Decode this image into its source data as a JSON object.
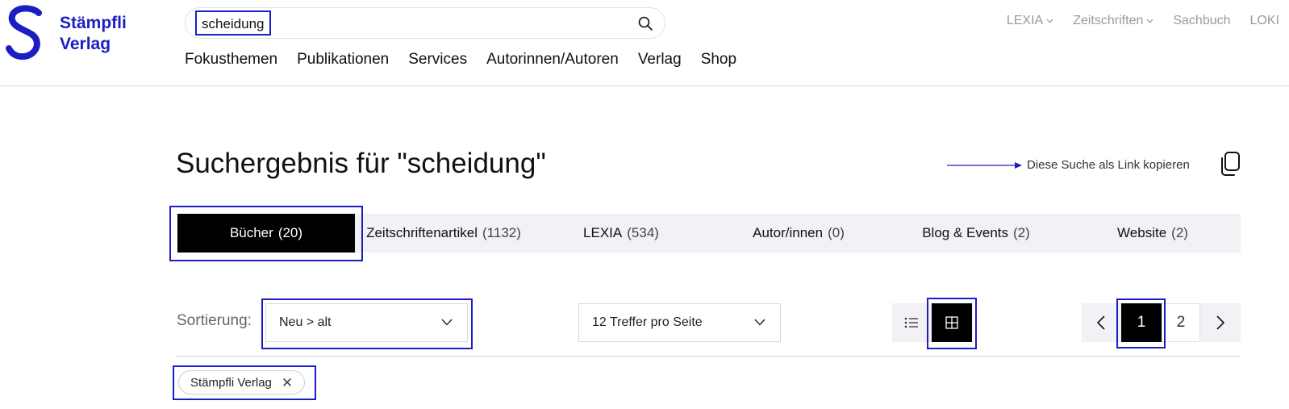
{
  "brand": {
    "line1": "Stämpfli",
    "line2": "Verlag",
    "color": "#1d1dc4"
  },
  "search": {
    "value": "scheidung",
    "icon": "search-icon"
  },
  "main_nav": [
    "Fokusthemen",
    "Publikationen",
    "Services",
    "Autorinnen/Autoren",
    "Verlag",
    "Shop"
  ],
  "top_nav": {
    "lexia": "LEXIA",
    "zeitschriften": "Zeitschriften",
    "sachbuch": "Sachbuch",
    "loki": "LOKI"
  },
  "results": {
    "title": "Suchergebnis für \"scheidung\"",
    "copy_link": "Diese Suche als Link kopieren"
  },
  "tabs": [
    {
      "label": "Bücher",
      "count": "(20)",
      "active": true
    },
    {
      "label": "Zeitschriftenartikel",
      "count": "(1132)"
    },
    {
      "label": "LEXIA",
      "count": "(534)"
    },
    {
      "label": "Autor/innen",
      "count": "(0)"
    },
    {
      "label": "Blog & Events",
      "count": "(2)"
    },
    {
      "label": "Website",
      "count": "(2)"
    }
  ],
  "controls": {
    "sort_label": "Sortierung:",
    "sort_value": "Neu > alt",
    "per_page_value": "12 Treffer pro Seite",
    "view_active": "grid"
  },
  "pagination": {
    "current": "1",
    "next_page": "2"
  },
  "filter_chip": {
    "label": "Stämpfli Verlag"
  },
  "colors": {
    "accent": "#1d1dc4",
    "tab_bar": "#f1f1f6",
    "active": "#000000"
  }
}
